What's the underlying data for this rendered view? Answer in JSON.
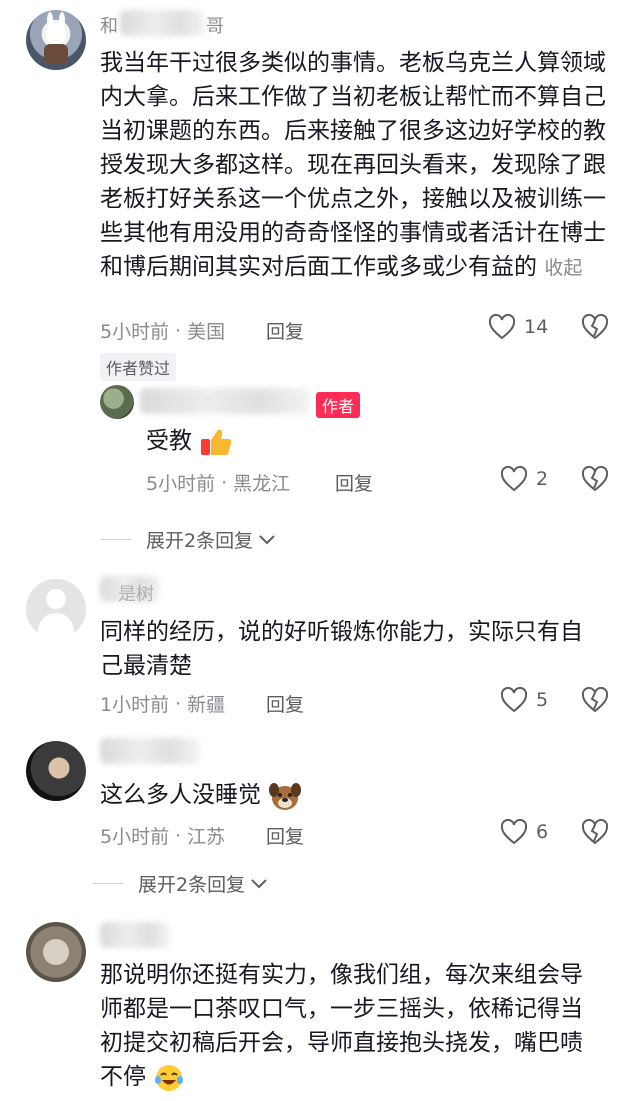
{
  "comments": [
    {
      "username": "和",
      "username_tail": "哥",
      "text": "我当年干过很多类似的事情。老板乌克兰人算领域内大拿。后来工作做了当初老板让帮忙而不算自己当初课题的东西。后来接触了很多这边好学校的教授发现大多都这样。现在再回头看来，发现除了跟老板打好关系这一个优点之外，接触以及被训练一些其他有用没用的奇奇怪怪的事情或者活计在博士和博后期间其实对后面工作或多或少有益的",
      "collapse": "收起",
      "time": "5小时前",
      "location": "美国",
      "reply_label": "回复",
      "likes": "14",
      "badge": "作者赞过"
    },
    {
      "author_tag": "作者",
      "text": "受教",
      "time": "5小时前",
      "location": "黑龙江",
      "reply_label": "回复",
      "likes": "2"
    },
    {
      "expand": "展开2条回复"
    },
    {
      "username_tail": "是树",
      "text_line1": "同样的经历，说的好听锻炼你能力，实际只有自",
      "text_line2": "己最清楚",
      "time": "1小时前",
      "location": "新疆",
      "reply_label": "回复",
      "likes": "5"
    },
    {
      "text": "这么多人没睡觉",
      "time": "5小时前",
      "location": "江苏",
      "reply_label": "回复",
      "likes": "6",
      "expand": "展开2条回复"
    },
    {
      "text_line1": "那说明你还挺有实力，像我们组，每次来组会导",
      "text_line2": "师都是一口茶叹口气，一步三摇头，依稀记得当",
      "text_line3": "初提交初稿后开会，导师直接抱头挠发，嘴巴啧",
      "text_line4": "不停"
    }
  ],
  "icons": {
    "like": "heart-outline-icon",
    "dislike": "broken-heart-icon",
    "expand": "chevron-down-icon"
  },
  "colors": {
    "author_tag": "#fe2c55",
    "meta": "#8a8b91"
  }
}
